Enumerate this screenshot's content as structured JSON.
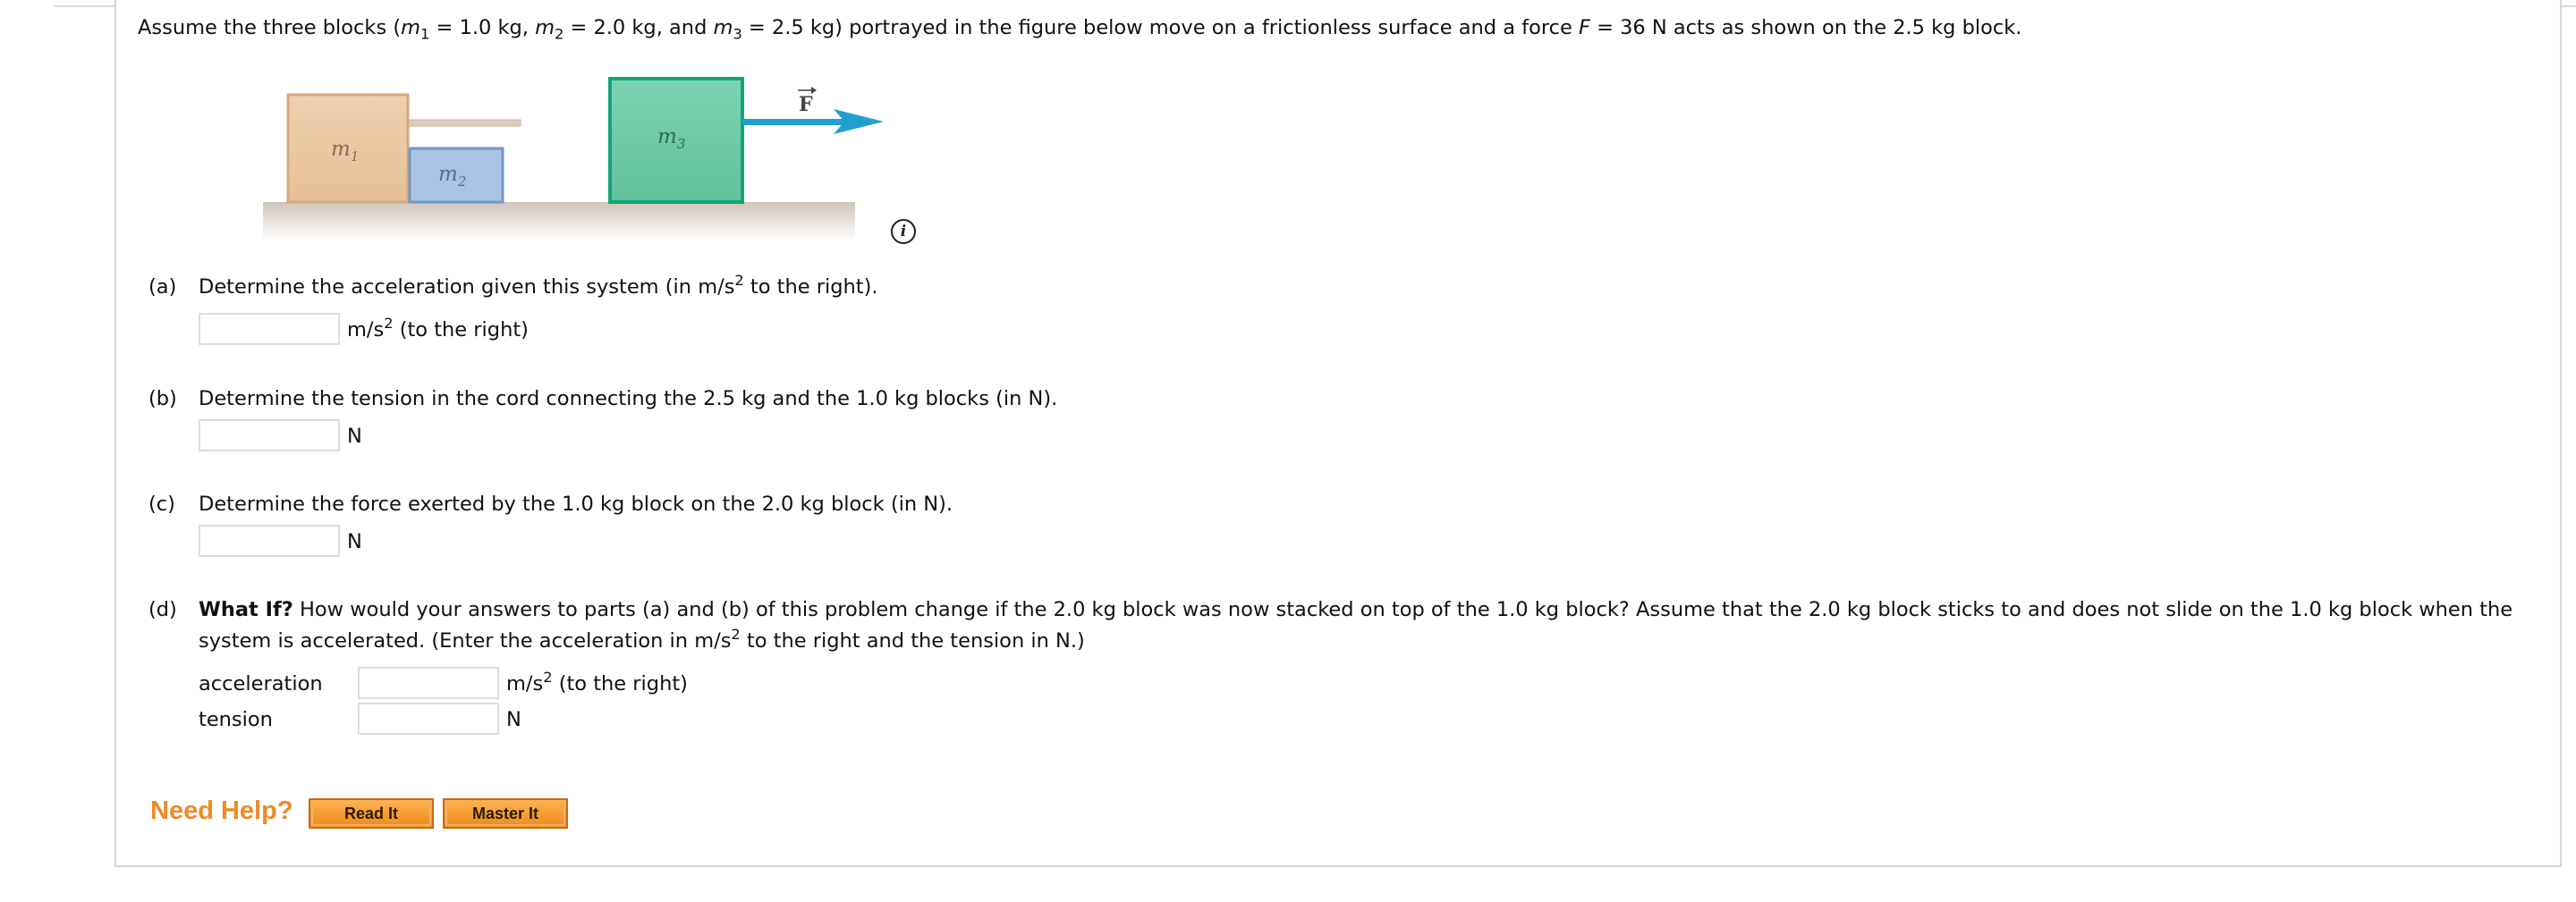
{
  "prompt": {
    "p1": "Assume the three blocks (",
    "m1_var": "m",
    "m1_sub": "1",
    "p2": " = 1.0 kg, ",
    "m2_var": "m",
    "m2_sub": "2",
    "p3": " = 2.0 kg, and ",
    "m3_var": "m",
    "m3_sub": "3",
    "p4": " = 2.5 kg) portrayed in the figure below move on a frictionless surface and a force ",
    "f_var": "F",
    "p5": " = 36 N acts as shown on the 2.5 kg block."
  },
  "figure": {
    "m1_label": "m",
    "m1_sub": "1",
    "m2_label": "m",
    "m2_sub": "2",
    "m3_label": "m",
    "m3_sub": "3",
    "force_label": "F",
    "info_icon_glyph": "i",
    "colors": {
      "m1": "#e9c7a1",
      "m2": "#a9c4e2",
      "m3": "#6fcaa8",
      "arrow": "#1fa0cf",
      "rope": "#d8c9b3",
      "ground": "#d2c6bd"
    }
  },
  "questions": {
    "a": {
      "label": "(a)",
      "text_before": "Determine the acceleration given this system (in m/s",
      "sup": "2",
      "text_after": " to the right).",
      "unit_before": "m/s",
      "unit_sup": "2",
      "unit_after": " (to the right)",
      "value": ""
    },
    "b": {
      "label": "(b)",
      "text": "Determine the tension in the cord connecting the 2.5 kg and the 1.0 kg blocks (in N).",
      "unit": "N",
      "value": ""
    },
    "c": {
      "label": "(c)",
      "text": "Determine the force exerted by the 1.0 kg block on the 2.0 kg block (in N).",
      "unit": "N",
      "value": ""
    },
    "d": {
      "label": "(d)",
      "bold": "What If?",
      "line1": " How would your answers to parts (a) and (b) of this problem change if the 2.0 kg block was now stacked on top of the 1.0 kg block? Assume that the 2.0 kg block sticks to and does not slide on the 1.0 kg block when the",
      "line2_before": "system is accelerated. (Enter the acceleration in m/s",
      "line2_sup": "2",
      "line2_after": " to the right and the tension in N.)",
      "accel_label": "acceleration",
      "accel_unit_before": "m/s",
      "accel_unit_sup": "2",
      "accel_unit_after": " (to the right)",
      "accel_value": "",
      "tension_label": "tension",
      "tension_unit": "N",
      "tension_value": ""
    }
  },
  "help": {
    "label": "Need Help?",
    "read_it": "Read It",
    "master_it": "Master It"
  }
}
